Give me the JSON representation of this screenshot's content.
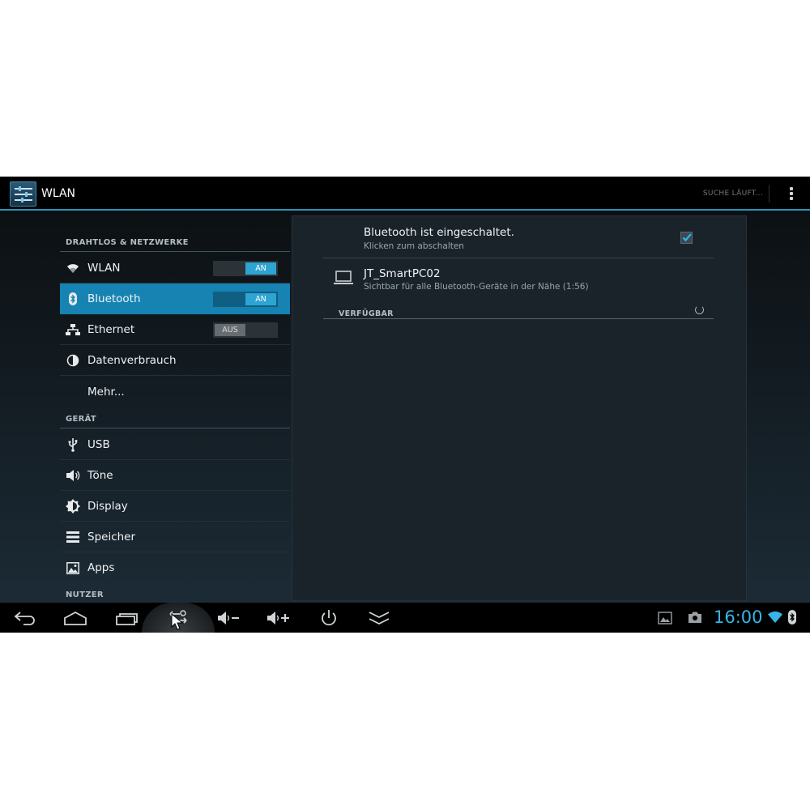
{
  "action_bar": {
    "title": "WLAN",
    "search_status": "SUCHE LÄUFT..."
  },
  "menu": {
    "sections": [
      {
        "header": "DRAHTLOS & NETZWERKE"
      },
      {
        "header": "GERÄT"
      },
      {
        "header": "NUTZER"
      }
    ],
    "items": [
      {
        "label": "WLAN",
        "icon": "wifi-icon",
        "toggle": "AN"
      },
      {
        "label": "Bluetooth",
        "icon": "bluetooth-icon",
        "toggle": "AN",
        "selected": true
      },
      {
        "label": "Ethernet",
        "icon": "ethernet-icon",
        "toggle": "AUS"
      },
      {
        "label": "Datenverbrauch",
        "icon": "data-usage-icon"
      },
      {
        "label": "Mehr..."
      },
      {
        "label": "USB",
        "icon": "usb-icon"
      },
      {
        "label": "Töne",
        "icon": "speaker-icon"
      },
      {
        "label": "Display",
        "icon": "brightness-icon"
      },
      {
        "label": "Speicher",
        "icon": "storage-icon"
      },
      {
        "label": "Apps",
        "icon": "apps-icon"
      }
    ]
  },
  "panel": {
    "bluetooth_title": "Bluetooth ist eingeschaltet.",
    "bluetooth_subtitle": "Klicken zum abschalten",
    "bluetooth_checked": true,
    "device_name": "JT_SmartPC02",
    "device_subtitle": "Sichtbar für alle Bluetooth-Geräte in der Nähe (1:56)",
    "available_header": "VERFÜGBAR"
  },
  "system_bar": {
    "clock": "16:00",
    "nav_buttons": [
      "back-icon",
      "home-icon",
      "recent-apps-icon",
      "screen-rotate-icon",
      "volume-down-icon",
      "volume-up-icon",
      "power-icon",
      "collapse-icon"
    ],
    "accent_color": "#35b4e6"
  }
}
